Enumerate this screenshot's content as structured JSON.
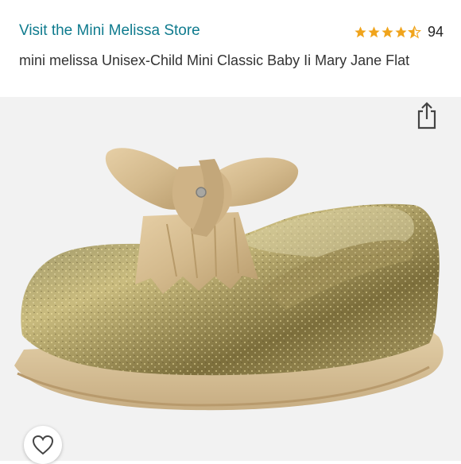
{
  "store": {
    "link_text": "Visit the Mini Melissa Store"
  },
  "rating": {
    "stars": 4.5,
    "count": "94",
    "star_color": "#f0a41c"
  },
  "product": {
    "title": "mini melissa Unisex-Child Mini Classic Baby Ii Mary Jane Flat",
    "image": "product-photo-gold-glitter-mary-jane-shoe-with-bow"
  },
  "actions": {
    "share_icon": "share-icon",
    "favorite_icon": "heart-icon"
  },
  "colors": {
    "link": "#0f7b8e",
    "shoe_gold": "#b9a35d",
    "bow": "#d5b98c"
  }
}
